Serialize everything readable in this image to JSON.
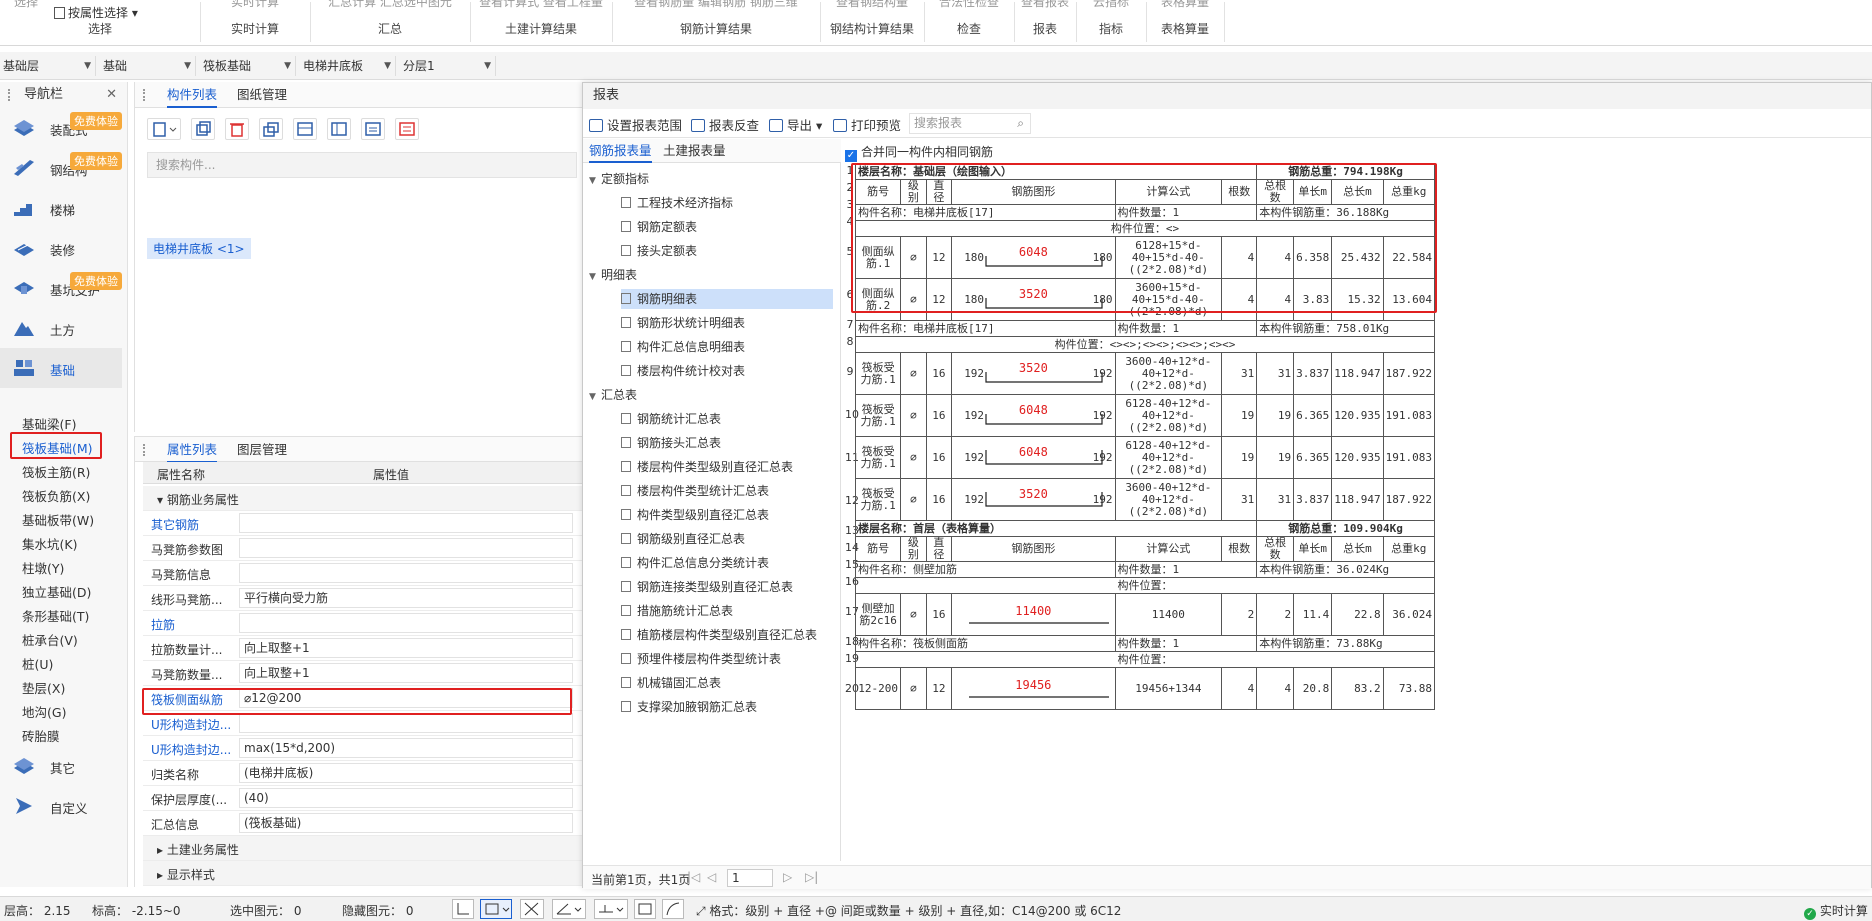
{
  "ribbon": {
    "groups": [
      {
        "label": "选择",
        "top": "选择",
        "extra": "按属性选择"
      },
      {
        "label": "实时计算",
        "top": "实时计算"
      },
      {
        "label": "汇总",
        "top": "汇总计算  汇总选中图元"
      },
      {
        "label": "土建计算结果",
        "top": "查看计算式  查看工程量"
      },
      {
        "label": "钢筋计算结果",
        "top": "查看钢筋量  编辑钢筋  钢筋三维"
      },
      {
        "label": "钢结构计算结果",
        "top": "查看钢结构量"
      },
      {
        "label": "检查",
        "top": "合法性检查"
      },
      {
        "label": "报表",
        "top": "查看报表"
      },
      {
        "label": "指标",
        "top": "云指标"
      },
      {
        "label": "表格算量",
        "top": "表格算量"
      }
    ]
  },
  "layerbar": {
    "d1": "基础层",
    "d2": "基础",
    "d3": "筏板基础",
    "d4": "电梯井底板",
    "d5": "分层1"
  },
  "nav": {
    "title": "导航栏",
    "items": [
      {
        "label": "装配式",
        "badge": "免费体验"
      },
      {
        "label": "钢结构",
        "badge": "免费体验"
      },
      {
        "label": "楼梯"
      },
      {
        "label": "装修"
      },
      {
        "label": "基坑支护",
        "badge": "免费体验"
      },
      {
        "label": "土方"
      },
      {
        "label": "基础"
      }
    ],
    "subitems": [
      "基础梁(F)",
      "筏板基础(M)",
      "筏板主筋(R)",
      "筏板负筋(X)",
      "基础板带(W)",
      "集水坑(K)",
      "柱墩(Y)",
      "独立基础(D)",
      "条形基础(T)",
      "桩承台(V)",
      "桩(U)",
      "垫层(X)",
      "地沟(G)",
      "砖胎膜"
    ],
    "bottom_items": [
      {
        "label": "其它"
      },
      {
        "label": "自定义"
      }
    ]
  },
  "complist": {
    "tab1": "构件列表",
    "tab2": "图纸管理",
    "search_placeholder": "搜索构件...",
    "item": "电梯井底板 <1>"
  },
  "props": {
    "tab1": "属性列表",
    "tab2": "图层管理",
    "col_name": "属性名称",
    "col_value": "属性值",
    "group1": "钢筋业务属性",
    "rows": [
      {
        "name": "其它钢筋",
        "value": "",
        "blue": true
      },
      {
        "name": "马凳筋参数图",
        "value": ""
      },
      {
        "name": "马凳筋信息",
        "value": ""
      },
      {
        "name": "线形马凳筋...",
        "value": "平行横向受力筋"
      },
      {
        "name": "拉筋",
        "value": "",
        "blue": true
      },
      {
        "name": "拉筋数量计...",
        "value": "向上取整+1"
      },
      {
        "name": "马凳筋数量...",
        "value": "向上取整+1"
      },
      {
        "name": "筏板侧面纵筋",
        "value": "⌀12@200",
        "blue": true
      },
      {
        "name": "U形构造封边...",
        "value": "",
        "blue": true
      },
      {
        "name": "U形构造封边...",
        "value": "max(15*d,200)",
        "blue": true
      },
      {
        "name": "归类名称",
        "value": "(电梯井底板)"
      },
      {
        "name": "保护层厚度(...",
        "value": "(40)"
      },
      {
        "name": "汇总信息",
        "value": "(筏板基础)"
      }
    ],
    "group2": "土建业务属性",
    "group3": "显示样式"
  },
  "dialog": {
    "title": "报表",
    "tools": {
      "t1": "设置报表范围",
      "t2": "报表反查",
      "t3": "导出",
      "t4": "打印预览"
    },
    "search_placeholder": "搜索报表",
    "tabs": {
      "t1": "钢筋报表量",
      "t2": "土建报表量"
    },
    "merge_label": "合并同一构件内相同钢筋",
    "tree": [
      {
        "kind": "group",
        "label": "定额指标"
      },
      {
        "kind": "leaf",
        "label": "工程技术经济指标"
      },
      {
        "kind": "leaf",
        "label": "钢筋定额表"
      },
      {
        "kind": "leaf",
        "label": "接头定额表"
      },
      {
        "kind": "group",
        "label": "明细表"
      },
      {
        "kind": "leaf",
        "label": "钢筋明细表",
        "selected": true
      },
      {
        "kind": "leaf",
        "label": "钢筋形状统计明细表"
      },
      {
        "kind": "leaf",
        "label": "构件汇总信息明细表"
      },
      {
        "kind": "leaf",
        "label": "楼层构件统计校对表"
      },
      {
        "kind": "group",
        "label": "汇总表"
      },
      {
        "kind": "leaf",
        "label": "钢筋统计汇总表"
      },
      {
        "kind": "leaf",
        "label": "钢筋接头汇总表"
      },
      {
        "kind": "leaf",
        "label": "楼层构件类型级别直径汇总表"
      },
      {
        "kind": "leaf",
        "label": "楼层构件类型统计汇总表"
      },
      {
        "kind": "leaf",
        "label": "构件类型级别直径汇总表"
      },
      {
        "kind": "leaf",
        "label": "钢筋级别直径汇总表"
      },
      {
        "kind": "leaf",
        "label": "构件汇总信息分类统计表"
      },
      {
        "kind": "leaf",
        "label": "钢筋连接类型级别直径汇总表"
      },
      {
        "kind": "leaf",
        "label": "措施筋统计汇总表"
      },
      {
        "kind": "leaf",
        "label": "植筋楼层构件类型级别直径汇总表"
      },
      {
        "kind": "leaf",
        "label": "预埋件楼层构件类型统计表"
      },
      {
        "kind": "leaf",
        "label": "机械锚固汇总表"
      },
      {
        "kind": "leaf",
        "label": "支撑梁加腋钢筋汇总表"
      }
    ],
    "pager": {
      "text": "当前第1页，共1页",
      "page": "1"
    }
  },
  "report": {
    "headers": [
      "筋号",
      "级别",
      "直径",
      "钢筋图形",
      "计算公式",
      "根数",
      "总根数",
      "单长m",
      "总长m",
      "总重kg"
    ],
    "floor1": {
      "name": "楼层名称：基础层（绘图输入）",
      "total": "钢筋总重：794.198Kg"
    },
    "comp1": {
      "name": "构件名称：电梯井底板[17]",
      "count": "构件数量：1",
      "weight": "本构件钢筋重：36.188Kg",
      "pos": "构件位置：<>"
    },
    "rows1": [
      {
        "no": "侧面纵筋.1",
        "grade": "⌀",
        "d": "12",
        "l": "180",
        "mid": "6048",
        "r": "180",
        "f": "6128+15*d-40+15*d-40-((2*2.08)*d)",
        "n": "4",
        "tn": "4",
        "ul": "6.358",
        "tl": "25.432",
        "tw": "22.584"
      },
      {
        "no": "侧面纵筋.2",
        "grade": "⌀",
        "d": "12",
        "l": "180",
        "mid": "3520",
        "r": "180",
        "f": "3600+15*d-40+15*d-40-((2*2.08)*d)",
        "n": "4",
        "tn": "4",
        "ul": "3.83",
        "tl": "15.32",
        "tw": "13.604"
      }
    ],
    "comp2": {
      "name": "构件名称：电梯井底板[17]",
      "count": "构件数量：1",
      "weight": "本构件钢筋重：758.01Kg",
      "pos": "构件位置：<><>;<><>;<><>;<><>"
    },
    "rows2": [
      {
        "no": "筏板受力筋.1",
        "grade": "⌀",
        "d": "16",
        "l": "192",
        "mid": "3520",
        "r": "192",
        "f": "3600-40+12*d-40+12*d-((2*2.08)*d)",
        "n": "31",
        "tn": "31",
        "ul": "3.837",
        "tl": "118.947",
        "tw": "187.922"
      },
      {
        "no": "筏板受力筋.1",
        "grade": "⌀",
        "d": "16",
        "l": "192",
        "mid": "6048",
        "r": "192",
        "f": "6128-40+12*d-40+12*d-((2*2.08)*d)",
        "n": "19",
        "tn": "19",
        "ul": "6.365",
        "tl": "120.935",
        "tw": "191.083"
      },
      {
        "no": "筏板受力筋.1",
        "grade": "⌀",
        "d": "16",
        "l": "192",
        "mid": "6048",
        "r": "192",
        "f": "6128-40+12*d-40+12*d-((2*2.08)*d)",
        "n": "19",
        "tn": "19",
        "ul": "6.365",
        "tl": "120.935",
        "tw": "191.083"
      },
      {
        "no": "筏板受力筋.1",
        "grade": "⌀",
        "d": "16",
        "l": "192",
        "mid": "3520",
        "r": "192",
        "f": "3600-40+12*d-40+12*d-((2*2.08)*d)",
        "n": "31",
        "tn": "31",
        "ul": "3.837",
        "tl": "118.947",
        "tw": "187.922"
      }
    ],
    "floor2": {
      "name": "楼层名称：首层（表格算量）",
      "total": "钢筋总重：109.904Kg"
    },
    "comp3": {
      "name": "构件名称：侧壁加筋",
      "count": "构件数量：1",
      "weight": "本构件钢筋重：36.024Kg",
      "pos": "构件位置："
    },
    "row3": {
      "no": "侧壁加筋2c16",
      "grade": "⌀",
      "d": "16",
      "mid": "11400",
      "f": "11400",
      "n": "2",
      "tn": "2",
      "ul": "11.4",
      "tl": "22.8",
      "tw": "36.024"
    },
    "comp4": {
      "name": "构件名称：筏板侧面筋",
      "count": "构件数量：1",
      "weight": "本构件钢筋重：73.88Kg",
      "pos": "构件位置："
    },
    "row4": {
      "no": "12-200",
      "grade": "⌀",
      "d": "12",
      "mid": "19456",
      "f": "19456+1344",
      "n": "4",
      "tn": "4",
      "ul": "20.8",
      "tl": "83.2",
      "tw": "73.88"
    }
  },
  "statusbar": {
    "floor_h": "层高：  2.15",
    "elev": "标高：  -2.15~0",
    "sel": "选中图元：  0",
    "hidden": "隐藏图元：  0",
    "format": "格式：级别 + 直径 +@ 间距或数量 + 级别 + 直径,如：C14@200 或 6C12",
    "realtime": "实时计算"
  },
  "colors": {
    "accent": "#1a5fd0",
    "highlight": "#e02020",
    "badge": "#f6a93b"
  }
}
